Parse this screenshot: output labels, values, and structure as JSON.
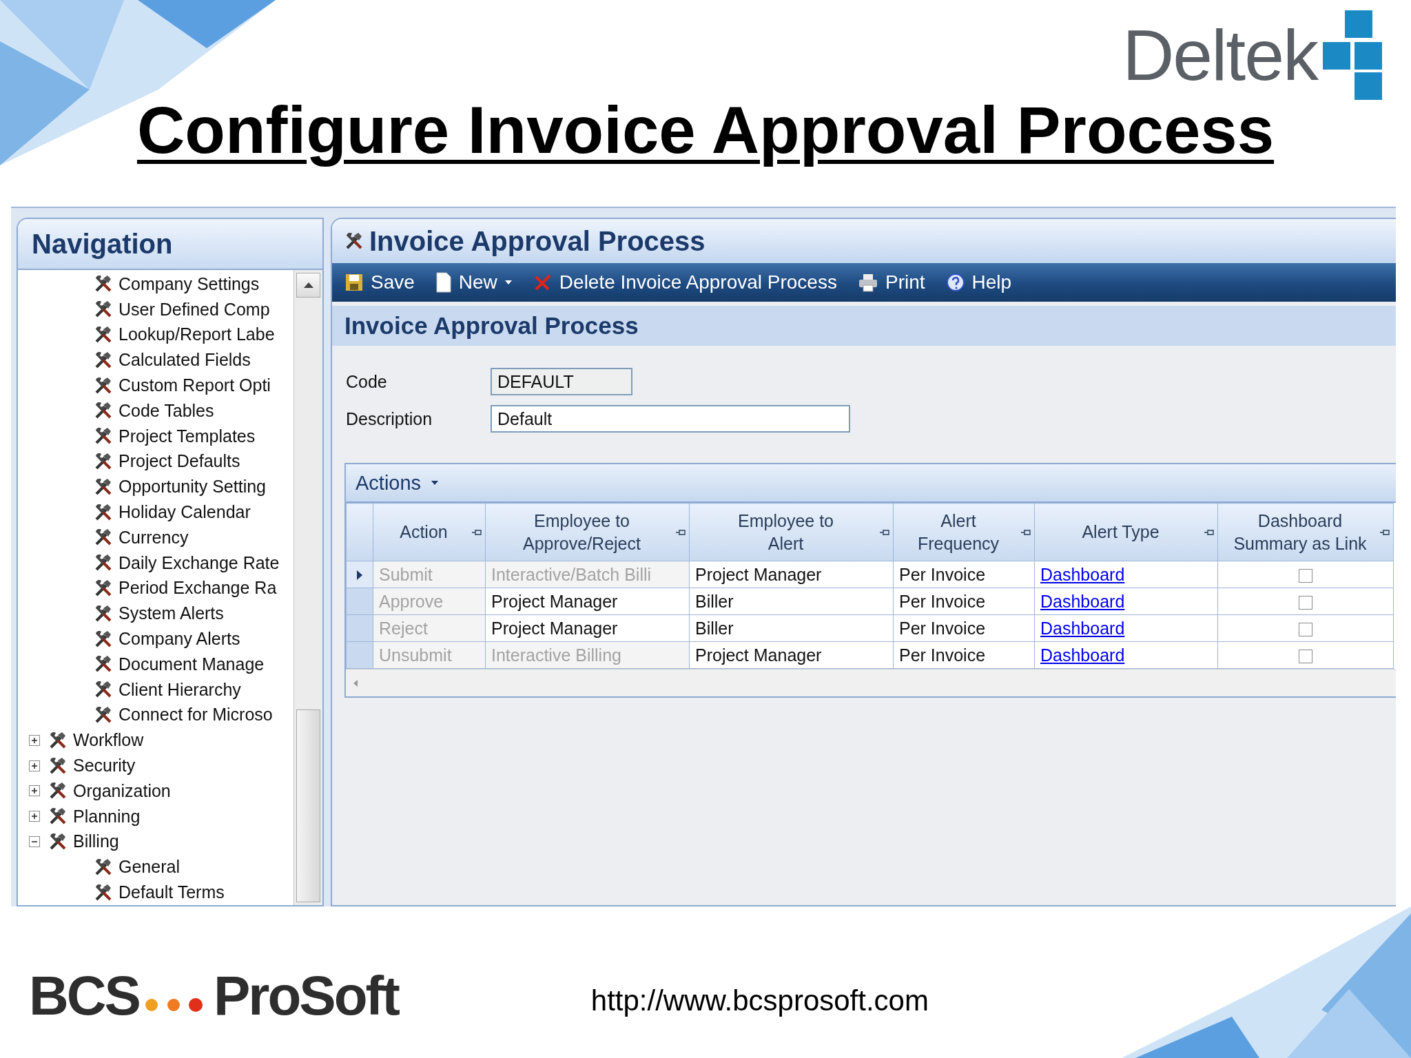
{
  "slide": {
    "title": "Configure Invoice Approval Process",
    "brand": "Deltek",
    "footer_brand": [
      "BCS",
      "ProSoft"
    ],
    "url": "http://www.bcsprosoft.com"
  },
  "navigation": {
    "title": "Navigation",
    "tree": [
      {
        "children": [
          {
            "label": "Company Settings"
          },
          {
            "label": "User Defined Comp"
          },
          {
            "label": "Lookup/Report Labe"
          },
          {
            "label": "Calculated Fields"
          },
          {
            "label": "Custom Report Opti"
          },
          {
            "label": "Code Tables"
          },
          {
            "label": "Project Templates"
          },
          {
            "label": "Project Defaults"
          },
          {
            "label": "Opportunity Setting"
          },
          {
            "label": "Holiday Calendar"
          },
          {
            "label": "Currency"
          },
          {
            "label": "Daily Exchange Rate"
          },
          {
            "label": "Period Exchange Ra"
          },
          {
            "label": "System Alerts"
          },
          {
            "label": "Company Alerts"
          },
          {
            "label": "Document Manage"
          },
          {
            "label": "Client Hierarchy"
          },
          {
            "label": "Connect for Microso"
          }
        ]
      },
      {
        "label": "Workflow",
        "expanded": false
      },
      {
        "label": "Security",
        "expanded": false
      },
      {
        "label": "Organization",
        "expanded": false
      },
      {
        "label": "Planning",
        "expanded": false
      },
      {
        "label": "Billing",
        "expanded": true,
        "children": [
          {
            "label": "General"
          },
          {
            "label": "Default Terms"
          }
        ]
      }
    ]
  },
  "panel": {
    "title": "Invoice Approval Process",
    "toolbar": [
      {
        "label": "Save",
        "dropdown": false
      },
      {
        "label": "New",
        "dropdown": true
      },
      {
        "label": "Delete Invoice Approval Process",
        "dropdown": false
      },
      {
        "label": "Print",
        "dropdown": false
      },
      {
        "label": "Help",
        "dropdown": false
      }
    ],
    "section_title": "Invoice Approval Process",
    "fields": [
      {
        "label": "Code",
        "value": "DEFAULT",
        "disabled": true
      },
      {
        "label": "Description",
        "value": "Default",
        "disabled": false
      }
    ],
    "grid": {
      "menu": "Actions",
      "columns": [
        {
          "lines": [
            "Action"
          ]
        },
        {
          "lines": [
            "Employee to",
            "Approve/Reject"
          ]
        },
        {
          "lines": [
            "Employee to",
            "Alert"
          ]
        },
        {
          "lines": [
            "Alert",
            "Frequency"
          ]
        },
        {
          "lines": [
            "Alert Type"
          ]
        },
        {
          "lines": [
            "Dashboard",
            "Summary as Link"
          ]
        }
      ],
      "rows": [
        {
          "selected": true,
          "cells": [
            {
              "text": "Submit",
              "disabled": true
            },
            {
              "text": "Interactive/Batch Billi",
              "disabled": true
            },
            {
              "text": "Project Manager",
              "disabled": false
            },
            {
              "text": "Per Invoice",
              "disabled": false
            }
          ],
          "alert_type": "Dashboard",
          "summary_link": false
        },
        {
          "selected": false,
          "cells": [
            {
              "text": "Approve",
              "disabled": true
            },
            {
              "text": "Project Manager",
              "disabled": false
            },
            {
              "text": "Biller",
              "disabled": false
            },
            {
              "text": "Per Invoice",
              "disabled": false
            }
          ],
          "alert_type": "Dashboard",
          "summary_link": false
        },
        {
          "selected": false,
          "cells": [
            {
              "text": "Reject",
              "disabled": true
            },
            {
              "text": "Project Manager",
              "disabled": false
            },
            {
              "text": "Biller",
              "disabled": false
            },
            {
              "text": "Per Invoice",
              "disabled": false
            }
          ],
          "alert_type": "Dashboard",
          "summary_link": false
        },
        {
          "selected": false,
          "cells": [
            {
              "text": "Unsubmit",
              "disabled": true
            },
            {
              "text": "Interactive Billing",
              "disabled": true
            },
            {
              "text": "Project Manager",
              "disabled": false
            },
            {
              "text": "Per Invoice",
              "disabled": false
            }
          ],
          "alert_type": "Dashboard",
          "summary_link": false
        }
      ]
    }
  }
}
